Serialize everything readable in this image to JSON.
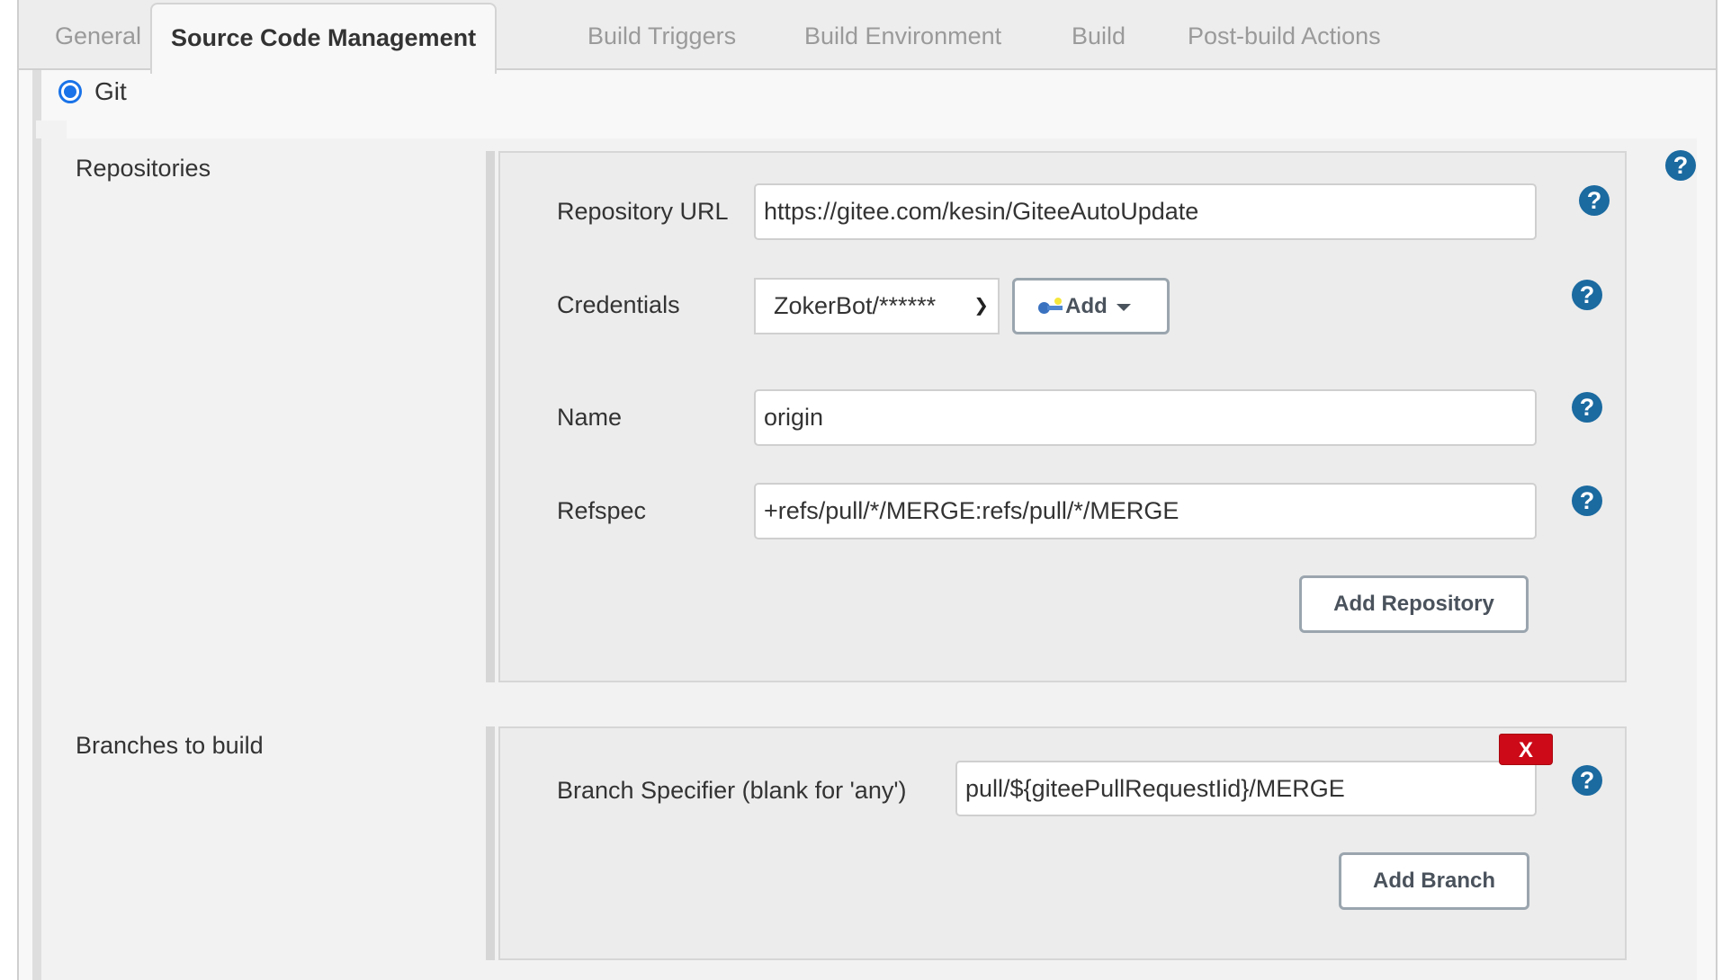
{
  "tabs": [
    {
      "label": "General",
      "active": false
    },
    {
      "label": "Source Code Management",
      "active": true
    },
    {
      "label": "Build Triggers",
      "active": false
    },
    {
      "label": "Build Environment",
      "active": false
    },
    {
      "label": "Build",
      "active": false
    },
    {
      "label": "Post-build Actions",
      "active": false
    }
  ],
  "scm": {
    "option_label": "Git",
    "selected": true
  },
  "repositories": {
    "section_label": "Repositories",
    "fields": {
      "url_label": "Repository URL",
      "url_value": "https://gitee.com/kesin/GiteeAutoUpdate",
      "credentials_label": "Credentials",
      "credentials_value": "ZokerBot/******",
      "add_credentials_label": "Add",
      "name_label": "Name",
      "name_value": "origin",
      "refspec_label": "Refspec",
      "refspec_value": "+refs/pull/*/MERGE:refs/pull/*/MERGE"
    },
    "add_repository_label": "Add Repository"
  },
  "branches": {
    "section_label": "Branches to build",
    "specifier_label": "Branch Specifier (blank for 'any')",
    "specifier_value": "pull/${giteePullRequestIid}/MERGE",
    "delete_label": "X",
    "add_branch_label": "Add Branch"
  },
  "help_label": "?",
  "colors": {
    "help_icon": "#1b6aa0",
    "delete_button": "#cc0a18",
    "radio_selected": "#1a73e8"
  }
}
